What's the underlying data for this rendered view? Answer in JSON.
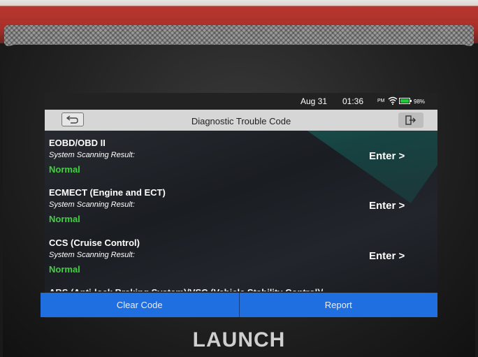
{
  "status_bar": {
    "date": "Aug 31",
    "time": "01:36",
    "ampm": "PM",
    "battery": "98%"
  },
  "header": {
    "title": "Diagnostic Trouble Code",
    "back_icon": "back-arrow-icon",
    "exit_icon": "exit-icon"
  },
  "systems": [
    {
      "name": "EOBD/OBD II",
      "label": "System Scanning Result:",
      "status": "Normal",
      "action": "Enter >"
    },
    {
      "name": "ECMECT (Engine and ECT)",
      "label": "System Scanning Result:",
      "status": "Normal",
      "action": "Enter >"
    },
    {
      "name": "CCS (Cruise Control)",
      "label": "System Scanning Result:",
      "status": "Normal",
      "action": "Enter >"
    },
    {
      "name": "ABS (Anti-lock Braking System)/VSC (Vehicle Stability Control)/"
    }
  ],
  "actions": {
    "clear_code": "Clear Code",
    "report": "Report"
  },
  "brand": "LAUNCH",
  "colors": {
    "status_normal": "#3fd13f",
    "action_bar": "#1f6fe0",
    "device_red": "#a8302a"
  }
}
